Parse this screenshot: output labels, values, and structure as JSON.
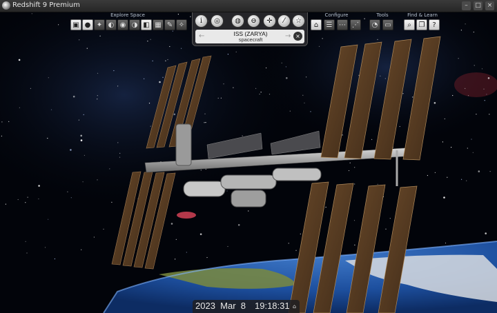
{
  "window": {
    "title": "Redshift 9 Premium",
    "controls": [
      "–",
      "□",
      "×"
    ]
  },
  "toolbar": {
    "groups": [
      {
        "label": "Explore Space"
      },
      {
        "label": "Configure"
      },
      {
        "label": "Tools"
      },
      {
        "label": "Find & Learn"
      }
    ],
    "explore_buttons": [
      "save-icon",
      "location-pin-icon",
      "comet-icon",
      "telescope-icon",
      "planet-icon",
      "moon-icon",
      "star-icon",
      "calendar-icon",
      "pen-icon",
      "satellite-icon"
    ],
    "configure_buttons": [
      "home-icon",
      "sliders-icon",
      "filter-icon",
      "chart-icon"
    ],
    "tools_buttons": [
      "measure-icon",
      "screen-icon"
    ],
    "find_buttons": [
      "magnifier-icon",
      "book-icon",
      "help-icon"
    ]
  },
  "info_panel": {
    "buttons": [
      "info-icon",
      "orbit-icon",
      "jupiter-icon",
      "saturn-icon",
      "target-icon",
      "telescope-icon",
      "favorite-star-icon"
    ],
    "info_glyph": "i",
    "object_name": "ISS (ZARYA)",
    "object_type": "spacecraft",
    "prev_arrow": "←",
    "next_arrow": "→",
    "close_glyph": "×"
  },
  "time_bar": {
    "date": "2023  Mar  8",
    "time": "19:18:31",
    "home_glyph": "⌂"
  },
  "colors": {
    "space": "#02040a",
    "earth_ocean": "#1d4f9e",
    "solar_panel": "#5a3d22",
    "toolbar_label": "#b9c4d2"
  }
}
